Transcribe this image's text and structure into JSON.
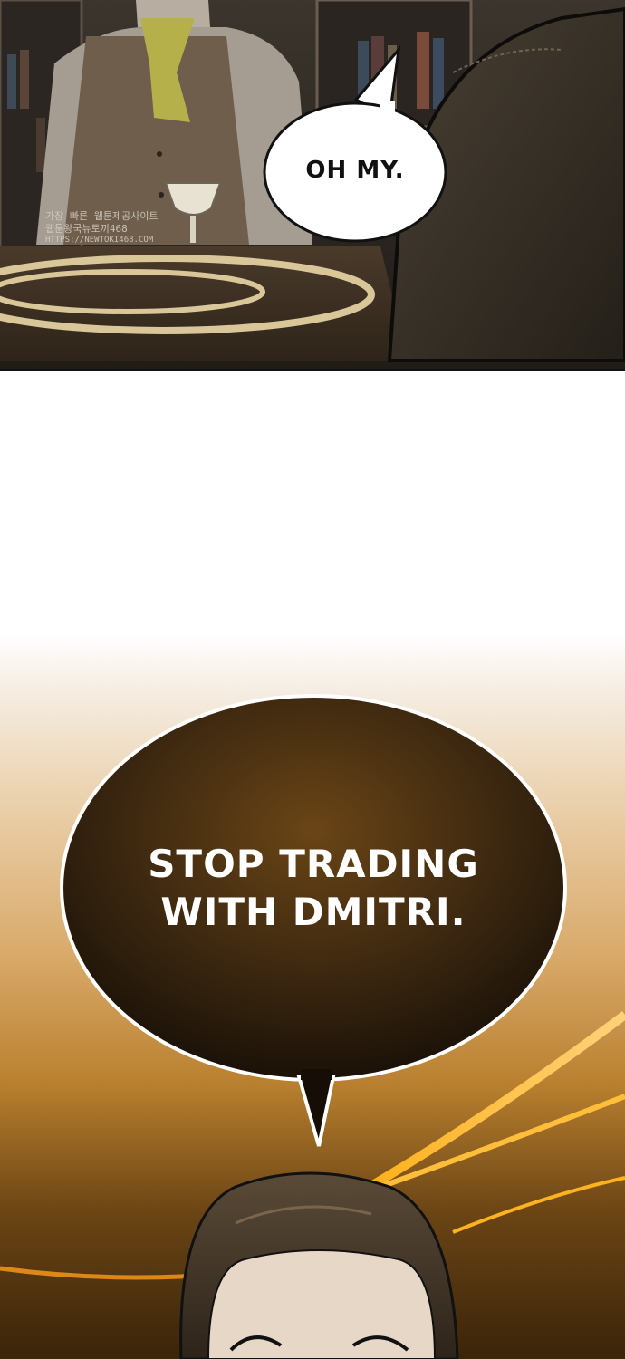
{
  "panels": {
    "top": {
      "speech": "OH MY.",
      "watermark": {
        "line1": "가장 빠른 웹툰제공사이트",
        "line2": "웹툰왕국뉴토끼468",
        "line3": "HTTPS://NEWTOKI468.COM"
      }
    },
    "bottom": {
      "speech_line1": "STOP TRADING",
      "speech_line2": "WITH DMITRI."
    }
  },
  "colors": {
    "speech_bubble_light": "#ffffff",
    "speech_bubble_dark": "#2b1c0c",
    "glow": "#ffb21e"
  }
}
